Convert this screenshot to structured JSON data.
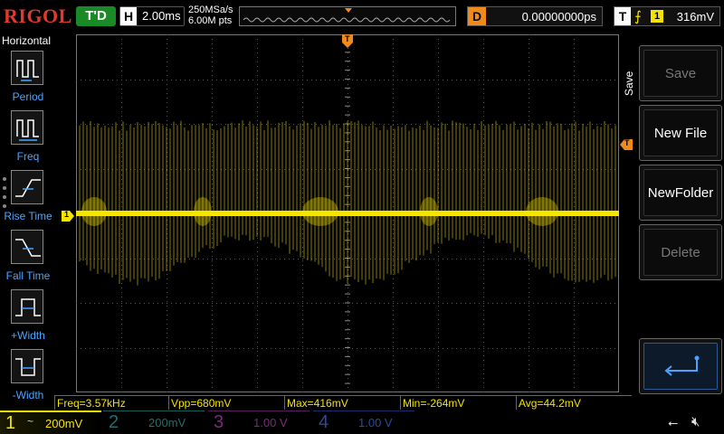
{
  "top": {
    "logo": "RIGOL",
    "trigger_status": "T'D",
    "horizontal_tag": "H",
    "timebase": "2.00ms",
    "sample_rate": "250MSa/s",
    "memory_depth": "6.00M pts",
    "memory_marker": "T",
    "delay_tag": "D",
    "delay": "0.00000000ps",
    "trigger_tag": "T",
    "trigger_edge": "⨍",
    "trigger_source": "1",
    "trigger_level": "316mV"
  },
  "left_menu": {
    "title": "Horizontal",
    "items": [
      {
        "label": "Period",
        "icon": "period-icon"
      },
      {
        "label": "Freq",
        "icon": "freq-icon"
      },
      {
        "label": "Rise Time",
        "icon": "rise-time-icon"
      },
      {
        "label": "Fall Time",
        "icon": "fall-time-icon"
      },
      {
        "label": "+Width",
        "icon": "pos-width-icon"
      },
      {
        "label": "-Width",
        "icon": "neg-width-icon"
      }
    ]
  },
  "right_menu": {
    "title": "Save",
    "buttons": [
      {
        "label": "Save",
        "enabled": false
      },
      {
        "label": "New File",
        "enabled": true
      },
      {
        "label": "NewFolder",
        "enabled": true
      },
      {
        "label": "Delete",
        "enabled": false
      }
    ],
    "back_icon": "return-arrow-icon"
  },
  "markers": {
    "trigger_position": "T",
    "trigger_level": "T",
    "ch1_ground": "1"
  },
  "measurements": {
    "freq": "Freq=3.57kHz",
    "vpp": "Vpp=680mV",
    "max": "Max=416mV",
    "min": "Min=-264mV",
    "avg": "Avg=44.2mV"
  },
  "channels": [
    {
      "num": "1",
      "coupling": "~",
      "scale": "200mV",
      "color": "#f5e300",
      "active": true
    },
    {
      "num": "2",
      "coupling": "",
      "scale": "200mV",
      "color": "#1f6f6f",
      "active": false
    },
    {
      "num": "3",
      "coupling": "",
      "scale": "1.00 V",
      "color": "#7a2a7a",
      "active": false
    },
    {
      "num": "4",
      "coupling": "",
      "scale": "1.00 V",
      "color": "#2a4a9a",
      "active": false
    }
  ],
  "status_icons": {
    "usb": "usb-icon",
    "sound": "speaker-muted-icon"
  },
  "colors": {
    "ch1": "#f5e300",
    "trigger": "#f08a1c",
    "status_ok": "#1a8a26",
    "brand": "#e23a2a"
  }
}
